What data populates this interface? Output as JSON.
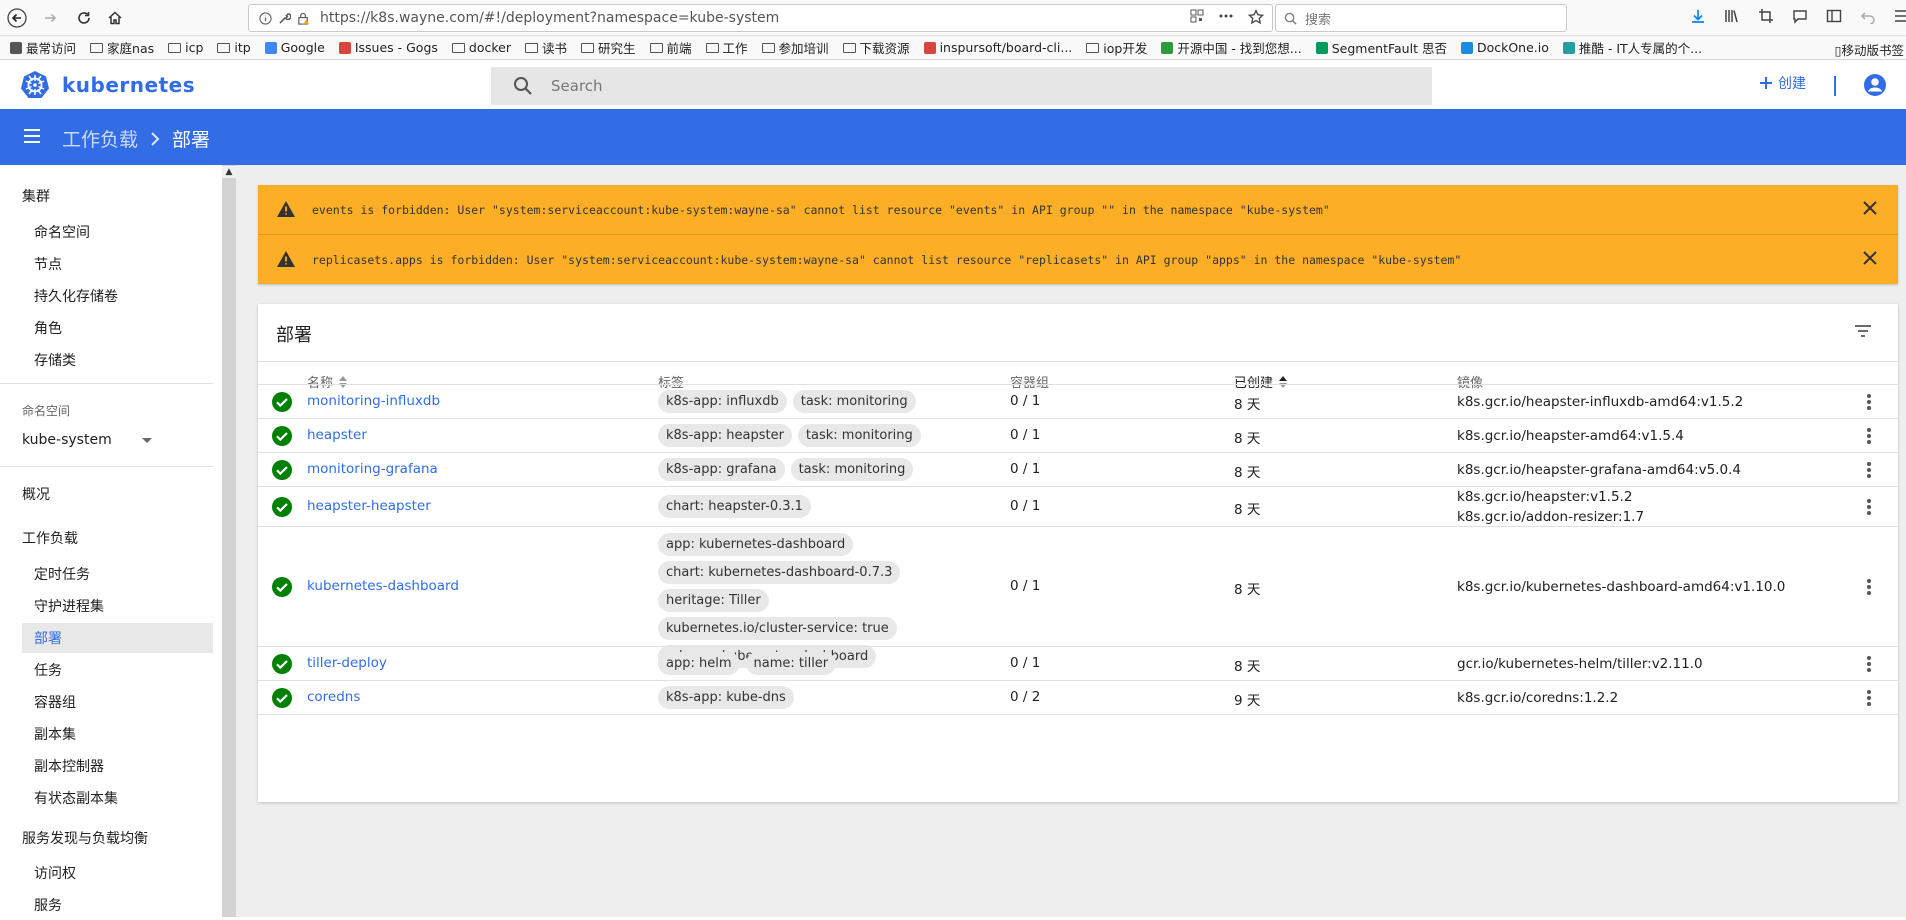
{
  "browser": {
    "url": "https://k8s.wayne.com/#!/deployment?namespace=kube-system",
    "search_placeholder": "搜索",
    "bookmarks": [
      {
        "label": "最常访问",
        "icon": "gear-icon"
      },
      {
        "label": "家庭nas",
        "icon": "folder-icon"
      },
      {
        "label": "icp",
        "icon": "folder-icon"
      },
      {
        "label": "itp",
        "icon": "folder-icon"
      },
      {
        "label": "Google",
        "icon": "google-icon"
      },
      {
        "label": "Issues - Gogs",
        "icon": "gogs-icon"
      },
      {
        "label": "docker",
        "icon": "folder-icon"
      },
      {
        "label": "读书",
        "icon": "folder-icon"
      },
      {
        "label": "研究生",
        "icon": "folder-icon"
      },
      {
        "label": "前端",
        "icon": "folder-icon"
      },
      {
        "label": "工作",
        "icon": "folder-icon"
      },
      {
        "label": "参加培训",
        "icon": "folder-icon"
      },
      {
        "label": "下载资源",
        "icon": "folder-icon"
      },
      {
        "label": "inspursoft/board-cli...",
        "icon": "gogs-icon"
      },
      {
        "label": "iop开发",
        "icon": "folder-icon"
      },
      {
        "label": "开源中国 - 找到您想...",
        "icon": "oschina-icon"
      },
      {
        "label": "SegmentFault 思否",
        "icon": "sf-icon"
      },
      {
        "label": "DockOne.io",
        "icon": "dockone-icon"
      },
      {
        "label": "推酷 - IT人专属的个...",
        "icon": "tuicool-icon"
      }
    ],
    "mobile_bookmarks": "移动版书签"
  },
  "header": {
    "logo_text": "kubernetes",
    "search_placeholder": "Search",
    "create_label": "创建"
  },
  "toolbar": {
    "breadcrumb_parent": "工作负载",
    "breadcrumb_current": "部署"
  },
  "sidebar": {
    "cluster_label": "集群",
    "cluster_items": [
      "命名空间",
      "节点",
      "持久化存储卷",
      "角色",
      "存储类"
    ],
    "namespace_label": "命名空间",
    "namespace_value": "kube-system",
    "overview_label": "概况",
    "workloads_label": "工作负载",
    "workload_items": [
      "定时任务",
      "守护进程集",
      "部署",
      "任务",
      "容器组",
      "副本集",
      "副本控制器",
      "有状态副本集"
    ],
    "discovery_label": "服务发现与负载均衡",
    "discovery_items": [
      "访问权",
      "服务"
    ]
  },
  "alerts": [
    "events is forbidden: User \"system:serviceaccount:kube-system:wayne-sa\" cannot list resource \"events\" in API group \"\" in the namespace \"kube-system\"",
    "replicasets.apps is forbidden: User \"system:serviceaccount:kube-system:wayne-sa\" cannot list resource \"replicasets\" in API group \"apps\" in the namespace \"kube-system\""
  ],
  "card": {
    "title": "部署",
    "columns": {
      "name": "名称",
      "labels": "标签",
      "pods": "容器组",
      "created": "已创建",
      "images": "镜像"
    },
    "rows": [
      {
        "name": "monitoring-influxdb",
        "labels": [
          "k8s-app: influxdb",
          "task: monitoring"
        ],
        "pods": "0 / 1",
        "age": "8 天",
        "images": [
          "k8s.gcr.io/heapster-influxdb-amd64:v1.5.2"
        ]
      },
      {
        "name": "heapster",
        "labels": [
          "k8s-app: heapster",
          "task: monitoring"
        ],
        "pods": "0 / 1",
        "age": "8 天",
        "images": [
          "k8s.gcr.io/heapster-amd64:v1.5.4"
        ]
      },
      {
        "name": "monitoring-grafana",
        "labels": [
          "k8s-app: grafana",
          "task: monitoring"
        ],
        "pods": "0 / 1",
        "age": "8 天",
        "images": [
          "k8s.gcr.io/heapster-grafana-amd64:v5.0.4"
        ]
      },
      {
        "name": "heapster-heapster",
        "labels": [
          "chart: heapster-0.3.1"
        ],
        "pods": "0 / 1",
        "age": "8 天",
        "images": [
          "k8s.gcr.io/heapster:v1.5.2",
          "k8s.gcr.io/addon-resizer:1.7"
        ]
      },
      {
        "name": "kubernetes-dashboard",
        "labels": [
          "app: kubernetes-dashboard",
          "chart: kubernetes-dashboard-0.7.3",
          "heritage: Tiller",
          "kubernetes.io/cluster-service: true",
          "release: kubernetes-dashboard"
        ],
        "pods": "0 / 1",
        "age": "8 天",
        "images": [
          "k8s.gcr.io/kubernetes-dashboard-amd64:v1.10.0"
        ]
      },
      {
        "name": "tiller-deploy",
        "labels": [
          "app: helm",
          "name: tiller"
        ],
        "pods": "0 / 1",
        "age": "8 天",
        "images": [
          "gcr.io/kubernetes-helm/tiller:v2.11.0"
        ]
      },
      {
        "name": "coredns",
        "labels": [
          "k8s-app: kube-dns"
        ],
        "pods": "0 / 2",
        "age": "9 天",
        "images": [
          "k8s.gcr.io/coredns:1.2.2"
        ]
      }
    ]
  },
  "colors": {
    "accent": "#326de6",
    "warning": "#fcaf26",
    "success": "#008000"
  }
}
